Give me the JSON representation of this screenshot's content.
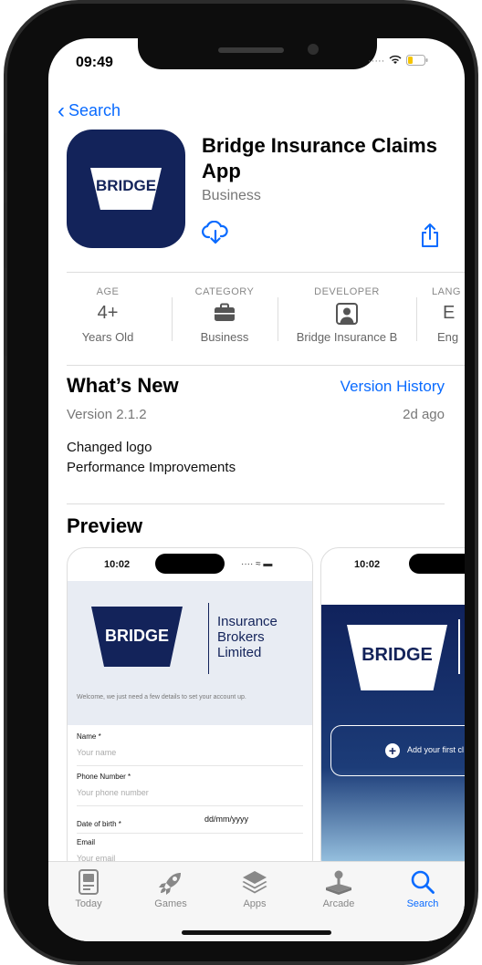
{
  "status": {
    "time": "09:49"
  },
  "nav": {
    "back_label": "Search"
  },
  "app": {
    "icon_text": "BRIDGE",
    "title": "Bridge Insurance Claims App",
    "category_sub": "Business"
  },
  "info": {
    "age": {
      "label": "AGE",
      "main": "4+",
      "sub": "Years Old"
    },
    "category": {
      "label": "CATEGORY",
      "sub": "Business"
    },
    "developer": {
      "label": "DEVELOPER",
      "sub": "Bridge Insurance B"
    },
    "language": {
      "label": "LANG",
      "main": "E",
      "sub": "Eng"
    }
  },
  "whats_new": {
    "title": "What’s New",
    "link": "Version History",
    "version": "Version 2.1.2",
    "ago": "2d ago",
    "notes": [
      "Changed logo",
      "Performance Improvements"
    ]
  },
  "preview": {
    "title": "Preview",
    "shot1": {
      "time": "10:02",
      "brand": "BRIDGE",
      "brand_lines": [
        "Insurance",
        "Brokers",
        "Limited"
      ],
      "welcome": "Welcome, we just need a few details to set your account up.",
      "fields": [
        {
          "label": "Name *",
          "placeholder": "Your name"
        },
        {
          "label": "Phone Number *",
          "placeholder": "Your phone number"
        },
        {
          "label": "Date of birth *",
          "placeholder": "dd/mm/yyyy"
        },
        {
          "label": "Email",
          "placeholder": "Your email"
        }
      ]
    },
    "shot2": {
      "time": "10:02",
      "brand": "BRIDGE",
      "add_label": "Add your first cl"
    }
  },
  "tabs": [
    {
      "label": "Today",
      "icon": "today-icon"
    },
    {
      "label": "Games",
      "icon": "rocket-icon"
    },
    {
      "label": "Apps",
      "icon": "apps-stack-icon"
    },
    {
      "label": "Arcade",
      "icon": "joystick-icon"
    },
    {
      "label": "Search",
      "icon": "search-icon",
      "active": true
    }
  ],
  "colors": {
    "accent": "#0a6bff",
    "brand_navy": "#13235a"
  }
}
